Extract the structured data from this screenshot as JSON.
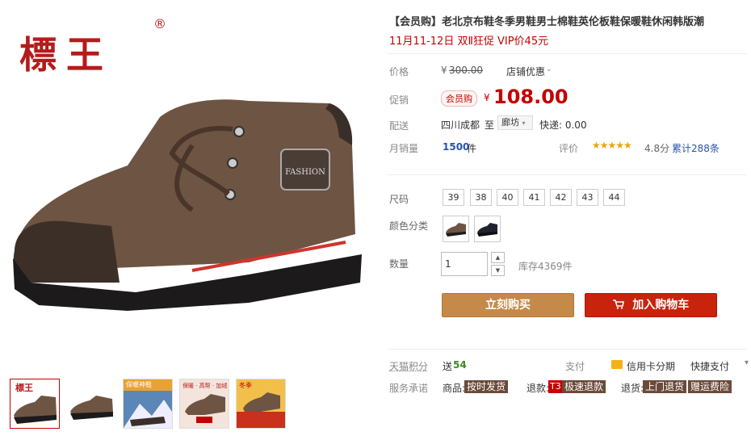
{
  "brand": {
    "logo_text": "標王",
    "registered": "®"
  },
  "product": {
    "title": "【会员购】老北京布鞋冬季男鞋男士棉鞋英伦板鞋保暖鞋休闲韩版潮",
    "promo": "11月11-12日 双Ⅱ狂促 VIP价45元",
    "shoe_label": "FASHION"
  },
  "price": {
    "label": "价格",
    "currency": "¥",
    "original": "300.00",
    "store_promo": "店铺优惠",
    "icon": "chevron-down-icon"
  },
  "promo_price": {
    "label": "促销",
    "tag": "会员购",
    "currency": "¥",
    "value": "108.00"
  },
  "delivery": {
    "label": "配送",
    "from": "四川成都",
    "to_word": "至",
    "destination": "廊坊",
    "shipping": "快递: 0.00"
  },
  "sales": {
    "label": "月销量",
    "count": "1500",
    "unit": "件",
    "rating_label": "评价",
    "stars": "★★★★★",
    "rating": "4.8分",
    "reviews": "累计288条"
  },
  "sizes": {
    "label": "尺码",
    "options": [
      "39",
      "38",
      "40",
      "41",
      "42",
      "43",
      "44"
    ]
  },
  "colors": {
    "label": "颜色分类"
  },
  "quantity": {
    "label": "数量",
    "value": "1",
    "stock": "库存4369件",
    "up": "▲",
    "down": "▼"
  },
  "actions": {
    "buy_now": "立刻购买",
    "add_cart": "加入购物车",
    "cart_icon": "cart-icon"
  },
  "points": {
    "label": "天猫积分",
    "text": "送",
    "value": "54"
  },
  "payment": {
    "label": "支付",
    "credit": "信用卡分期",
    "quick": "快捷支付",
    "more": "▾"
  },
  "service": {
    "label": "服务承诺",
    "shop_label": "商品:",
    "shop_badge": "按时发货",
    "refund_label": "退款:",
    "refund_t3": "T3",
    "refund_badge": "极速退款",
    "return_label": "退货:",
    "return_badge": "上门退货",
    "freight_badge": "赠运费险"
  },
  "thumbs": {
    "t3_text": "保暖神鞋",
    "t4_text": "保暖 · 高帮 · 加绒",
    "t5_text": "冬季"
  },
  "colors_theme": {
    "accent_red": "#c40000",
    "buy_btn": "#c58a4a",
    "cart_btn": "#c8230d"
  }
}
